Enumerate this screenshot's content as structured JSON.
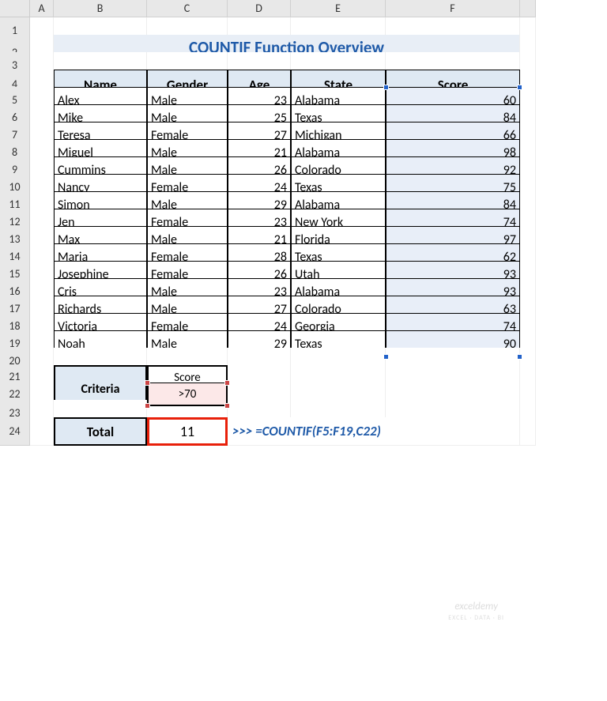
{
  "columns": [
    "A",
    "B",
    "C",
    "D",
    "E",
    "F"
  ],
  "title": "COUNTIF Function Overview",
  "headers": {
    "name": "Name",
    "gender": "Gender",
    "age": "Age",
    "state": "State",
    "score": "Score"
  },
  "rows": [
    {
      "name": "Alex",
      "gender": "Male",
      "age": 23,
      "state": "Alabama",
      "score": 60
    },
    {
      "name": "Mike",
      "gender": "Male",
      "age": 25,
      "state": "Texas",
      "score": 84
    },
    {
      "name": "Teresa",
      "gender": "Female",
      "age": 27,
      "state": "Michigan",
      "score": 66
    },
    {
      "name": "Miguel",
      "gender": "Male",
      "age": 21,
      "state": "Alabama",
      "score": 98
    },
    {
      "name": "Cummins",
      "gender": "Male",
      "age": 26,
      "state": "Colorado",
      "score": 92
    },
    {
      "name": "Nancy",
      "gender": "Female",
      "age": 24,
      "state": "Texas",
      "score": 75
    },
    {
      "name": "Simon",
      "gender": "Male",
      "age": 29,
      "state": "Alabama",
      "score": 84
    },
    {
      "name": "Jen",
      "gender": "Female",
      "age": 23,
      "state": "New York",
      "score": 74
    },
    {
      "name": "Max",
      "gender": "Male",
      "age": 21,
      "state": "Florida",
      "score": 97
    },
    {
      "name": "Maria",
      "gender": "Female",
      "age": 28,
      "state": "Texas",
      "score": 62
    },
    {
      "name": "Josephine",
      "gender": "Female",
      "age": 26,
      "state": "Utah",
      "score": 93
    },
    {
      "name": "Cris",
      "gender": "Male",
      "age": 23,
      "state": "Alabama",
      "score": 93
    },
    {
      "name": "Richards",
      "gender": "Male",
      "age": 27,
      "state": "Colorado",
      "score": 63
    },
    {
      "name": "Victoria",
      "gender": "Female",
      "age": 24,
      "state": "Georgia",
      "score": 74
    },
    {
      "name": "Noah",
      "gender": "Male",
      "age": 29,
      "state": "Texas",
      "score": 90
    }
  ],
  "criteria": {
    "label": "Criteria",
    "field": "Score",
    "value": ">70"
  },
  "total": {
    "label": "Total",
    "value": 11
  },
  "formula": ">>> =COUNTIF(F5:F19,C22)",
  "watermark": {
    "main": "exceldemy",
    "sub": "EXCEL · DATA · BI"
  },
  "chart_data": {
    "type": "table",
    "title": "COUNTIF Function Overview",
    "columns": [
      "Name",
      "Gender",
      "Age",
      "State",
      "Score"
    ],
    "data": [
      [
        "Alex",
        "Male",
        23,
        "Alabama",
        60
      ],
      [
        "Mike",
        "Male",
        25,
        "Texas",
        84
      ],
      [
        "Teresa",
        "Female",
        27,
        "Michigan",
        66
      ],
      [
        "Miguel",
        "Male",
        21,
        "Alabama",
        98
      ],
      [
        "Cummins",
        "Male",
        26,
        "Colorado",
        92
      ],
      [
        "Nancy",
        "Female",
        24,
        "Texas",
        75
      ],
      [
        "Simon",
        "Male",
        29,
        "Alabama",
        84
      ],
      [
        "Jen",
        "Female",
        23,
        "New York",
        74
      ],
      [
        "Max",
        "Male",
        21,
        "Florida",
        97
      ],
      [
        "Maria",
        "Female",
        28,
        "Texas",
        62
      ],
      [
        "Josephine",
        "Female",
        26,
        "Utah",
        93
      ],
      [
        "Cris",
        "Male",
        23,
        "Alabama",
        93
      ],
      [
        "Richards",
        "Male",
        27,
        "Colorado",
        63
      ],
      [
        "Victoria",
        "Female",
        24,
        "Georgia",
        74
      ],
      [
        "Noah",
        "Male",
        29,
        "Texas",
        90
      ]
    ],
    "criteria": "Score >70",
    "result": 11,
    "formula": "=COUNTIF(F5:F19,C22)"
  }
}
